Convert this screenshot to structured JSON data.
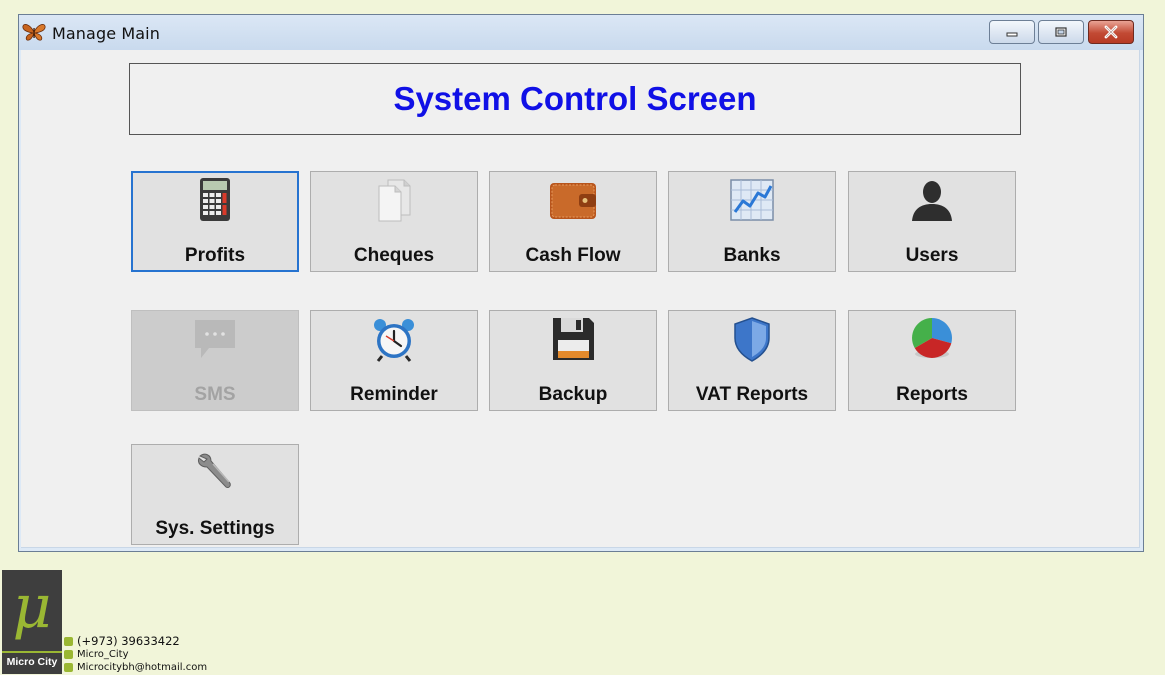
{
  "window": {
    "title": "Manage Main",
    "controls": {
      "minimize": "minimize",
      "maximize": "maximize",
      "close": "close"
    }
  },
  "header": {
    "title": "System Control Screen"
  },
  "tiles": [
    {
      "label": "Profits",
      "icon": "calculator-icon",
      "selected": true
    },
    {
      "label": "Cheques",
      "icon": "documents-icon"
    },
    {
      "label": "Cash Flow",
      "icon": "wallet-icon"
    },
    {
      "label": "Banks",
      "icon": "line-chart-icon"
    },
    {
      "label": "Users",
      "icon": "user-icon"
    },
    {
      "label": "SMS",
      "icon": "chat-bubble-icon",
      "disabled": true
    },
    {
      "label": "Reminder",
      "icon": "alarm-clock-icon"
    },
    {
      "label": "Backup",
      "icon": "floppy-disk-icon"
    },
    {
      "label": "VAT Reports",
      "icon": "shield-icon"
    },
    {
      "label": "Reports",
      "icon": "pie-chart-icon"
    },
    {
      "label": "Sys. Settings",
      "icon": "wrench-icon"
    }
  ],
  "footer": {
    "logo_symbol": "μ",
    "logo_text": "Micro City",
    "phone": "(+973) 39633422",
    "instagram": "Micro_City",
    "email": "Microcitybh@hotmail.com"
  },
  "colors": {
    "accent_title": "#1010e6",
    "selection_border": "#2673d0",
    "brand_green": "#9ab733",
    "page_background": "#f1f5d9"
  }
}
